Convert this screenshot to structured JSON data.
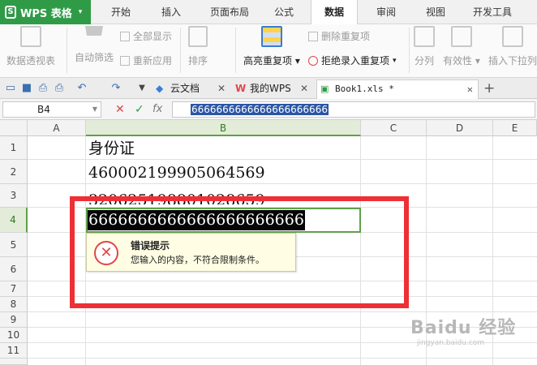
{
  "app": {
    "menu_label": "WPS 表格"
  },
  "menu_tabs": [
    "开始",
    "插入",
    "页面布局",
    "公式",
    "数据",
    "审阅",
    "视图",
    "开发工具"
  ],
  "ribbon": {
    "pivot": "数据透视表",
    "autofilter": "自动筛选",
    "show_all": "全部显示",
    "reapply": "重新应用",
    "sort": "排序",
    "highlight_dup": "高亮重复项",
    "remove_dup": "删除重复项",
    "reject_dup": "拒绝录入重复项",
    "split": "分列",
    "validity": "有效性",
    "insert_dropdown": "插入下拉列"
  },
  "doc_tabs": [
    "云文档",
    "我的WPS",
    "Book1.xls *"
  ],
  "formula_bar": {
    "name_box": "B4",
    "fx_label": "fx",
    "content": "6666666666666666666666"
  },
  "columns": [
    "A",
    "B",
    "C",
    "D",
    "E"
  ],
  "rows": [
    "1",
    "2",
    "3",
    "4",
    "5",
    "6",
    "7",
    "8",
    "9",
    "10",
    "11"
  ],
  "cells": {
    "B1": "身份证",
    "B2": "460002199905064569",
    "B3": "320625198801028659",
    "B4": "6666666666666666666666"
  },
  "error_tip": {
    "title": "错误提示",
    "message": "您输入的内容，不符合限制条件。"
  },
  "watermark": {
    "brand": "Baidu 经验",
    "url": "jingyan.baidu.com"
  },
  "colors": {
    "wps_green": "#2f9b47",
    "error_red": "#ee2f35",
    "tip_bg": "#fffde3"
  }
}
